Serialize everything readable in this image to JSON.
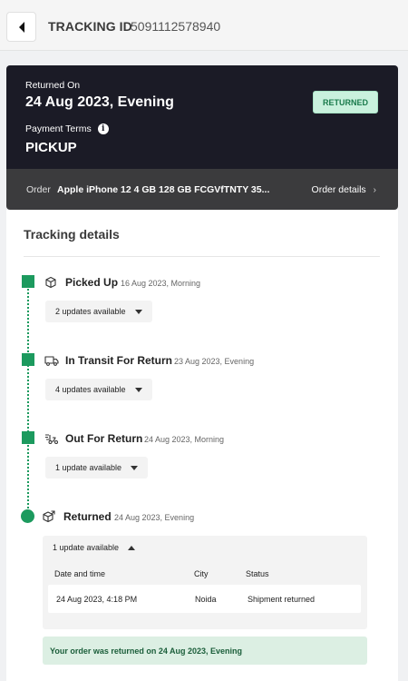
{
  "header": {
    "tracking_label": "TRACKING ID",
    "tracking_id": "5091112578940",
    "back_icon": "back-arrow-icon"
  },
  "summary": {
    "returned_on_label": "Returned On",
    "returned_on_value": "24 Aug 2023, Evening",
    "status_badge": "RETURNED",
    "payment_terms_label": "Payment Terms",
    "payment_terms_value": "PICKUP",
    "info_icon_glyph": "i"
  },
  "order": {
    "label": "Order",
    "name": "Apple iPhone 12 4 GB 128 GB FCGVfTNTY 35...",
    "details_link": "Order details",
    "chevron": "›"
  },
  "tracking": {
    "title": "Tracking details",
    "steps": [
      {
        "title": "Picked Up",
        "time": "16 Aug 2023, Morning",
        "updates": "2 updates available",
        "icon": "box-icon"
      },
      {
        "title": "In Transit For Return",
        "time": "23 Aug 2023, Evening",
        "updates": "4 updates available",
        "icon": "truck-icon"
      },
      {
        "title": "Out For Return",
        "time": "24 Aug 2023, Morning",
        "updates": "1 update available",
        "icon": "scooter-icon"
      },
      {
        "title": "Returned",
        "time": "24 Aug 2023, Evening",
        "updates": "1 update available",
        "icon": "return-box-icon"
      }
    ],
    "table": {
      "headers": [
        "Date and time",
        "City",
        "Status"
      ],
      "rows": [
        [
          "24 Aug 2023, 4:18 PM",
          "Noida",
          "Shipment returned"
        ]
      ]
    },
    "success_message": "Your order was returned on 24 Aug 2023, Evening"
  },
  "colors": {
    "accent_green": "#1c9a5e",
    "dark_card": "#1b1b26",
    "badge_bg": "#c9f1dd"
  }
}
